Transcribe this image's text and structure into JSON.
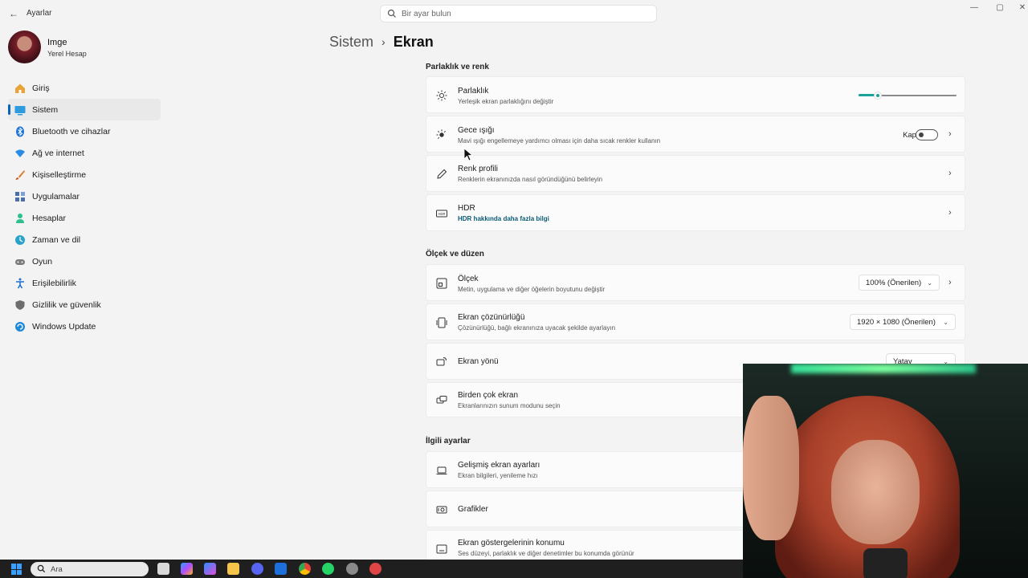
{
  "window": {
    "app_title": "Ayarlar",
    "back_glyph": "←",
    "minimize_glyph": "—",
    "maximize_glyph": "▢",
    "close_glyph": "✕"
  },
  "search": {
    "placeholder": "Bir ayar bulun"
  },
  "profile": {
    "name": "Imge",
    "account_type": "Yerel Hesap"
  },
  "sidebar": {
    "items": [
      {
        "label": "Giriş",
        "icon": "home-icon",
        "color": "#e8a33a"
      },
      {
        "label": "Sistem",
        "icon": "system-icon",
        "color": "#2d9be0",
        "active": true
      },
      {
        "label": "Bluetooth ve cihazlar",
        "icon": "bluetooth-icon",
        "color": "#1a73d9"
      },
      {
        "label": "Ağ ve internet",
        "icon": "wifi-icon",
        "color": "#2a8be5"
      },
      {
        "label": "Kişiselleştirme",
        "icon": "brush-icon",
        "color": "#e0782b"
      },
      {
        "label": "Uygulamalar",
        "icon": "apps-icon",
        "color": "#4a6ea8"
      },
      {
        "label": "Hesaplar",
        "icon": "account-icon",
        "color": "#2fbf8f"
      },
      {
        "label": "Zaman ve dil",
        "icon": "globe-clock-icon",
        "color": "#2aa3c9"
      },
      {
        "label": "Oyun",
        "icon": "gamepad-icon",
        "color": "#7b7b7b"
      },
      {
        "label": "Erişilebilirlik",
        "icon": "accessibility-icon",
        "color": "#1d6fd1"
      },
      {
        "label": "Gizlilik ve güvenlik",
        "icon": "shield-icon",
        "color": "#6d6d6d"
      },
      {
        "label": "Windows Update",
        "icon": "update-icon",
        "color": "#1e88d9"
      }
    ]
  },
  "header": {
    "parent": "Sistem",
    "separator": "›",
    "current": "Ekran"
  },
  "sections": {
    "brightness_color": "Parlaklık ve renk",
    "scale_layout": "Ölçek ve düzen",
    "related": "İlgili ayarlar"
  },
  "settings": {
    "brightness": {
      "title": "Parlaklık",
      "subtitle": "Yerleşik ekran parlaklığını değiştir",
      "value_percent": 20
    },
    "night_light": {
      "title": "Gece ışığı",
      "subtitle": "Mavi ışığı engellemeye yardımcı olması için daha sıcak renkler kullanın",
      "state_label": "Kapalı"
    },
    "color_profile": {
      "title": "Renk profili",
      "subtitle": "Renklerin ekranınızda nasıl göründüğünü belirleyin"
    },
    "hdr": {
      "title": "HDR",
      "link": "HDR hakkında daha fazla bilgi"
    },
    "scale": {
      "title": "Ölçek",
      "subtitle": "Metin, uygulama ve diğer öğelerin boyutunu değiştir",
      "value": "100% (Önerilen)"
    },
    "resolution": {
      "title": "Ekran çözünürlüğü",
      "subtitle": "Çözünürlüğü, bağlı ekranınıza uyacak şekilde ayarlayın",
      "value": "1920 × 1080 (Önerilen)"
    },
    "orientation": {
      "title": "Ekran yönü",
      "value": "Yatay"
    },
    "multi_display": {
      "title": "Birden çok ekran",
      "subtitle": "Ekranlarınızın sunum modunu seçin"
    },
    "advanced_display": {
      "title": "Gelişmiş ekran ayarları",
      "subtitle": "Ekran bilgileri, yenileme hızı"
    },
    "graphics": {
      "title": "Grafikler"
    },
    "indicator_position": {
      "title": "Ekran göstergelerinin konumu",
      "subtitle": "Ses düzeyi, parlaklık ve diğer denetimler bu konumda görünür"
    }
  },
  "taskbar": {
    "search_label": "Ara"
  },
  "colors": {
    "accent": "#1aa39a",
    "link": "#0b5a74",
    "nav_indicator": "#0a66b8"
  }
}
